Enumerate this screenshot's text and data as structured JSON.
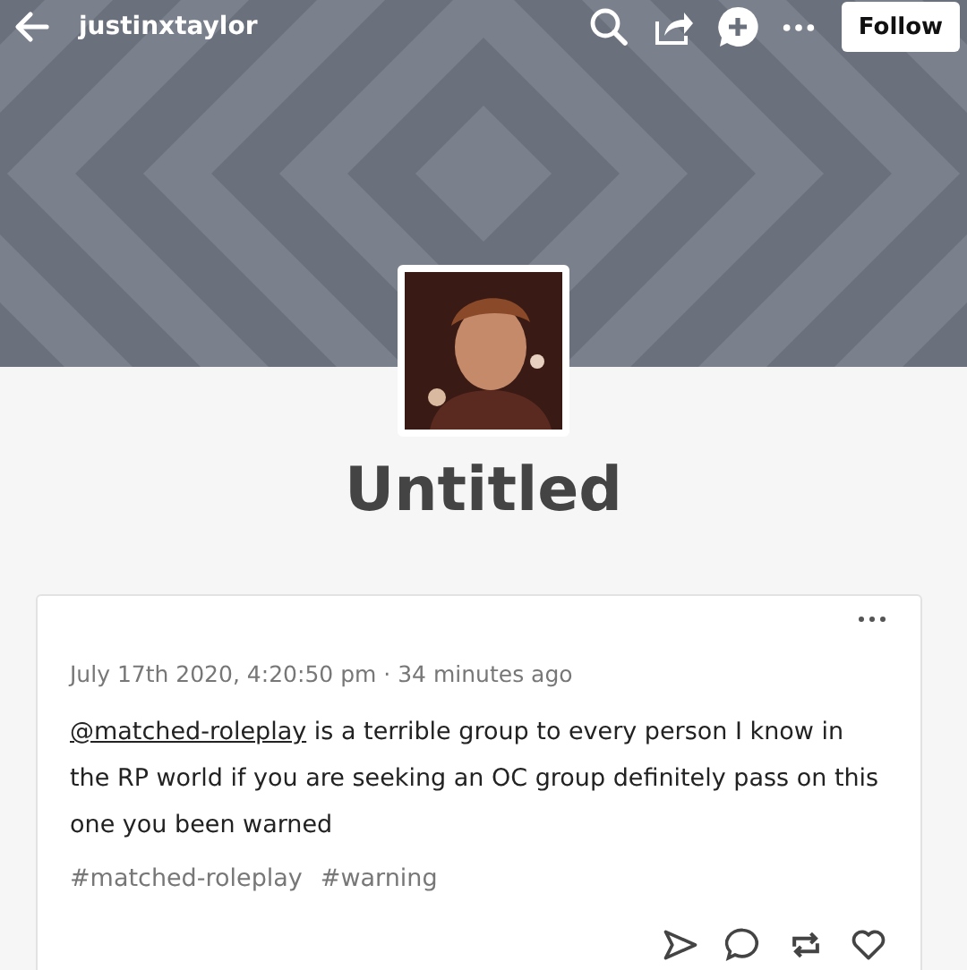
{
  "top_bar": {
    "blog_name": "justinxtaylor",
    "follow_label": "Follow"
  },
  "title": "Untitled",
  "post": {
    "timestamp": "July 17th 2020, 4:20:50 pm · 34 minutes ago",
    "mention": "@matched-roleplay",
    "text": "is a terrible group to every person I know in the RP world if you are seeking an OC group definitely pass on this one you been warned",
    "tags": [
      "#matched-roleplay",
      "#warning"
    ]
  }
}
